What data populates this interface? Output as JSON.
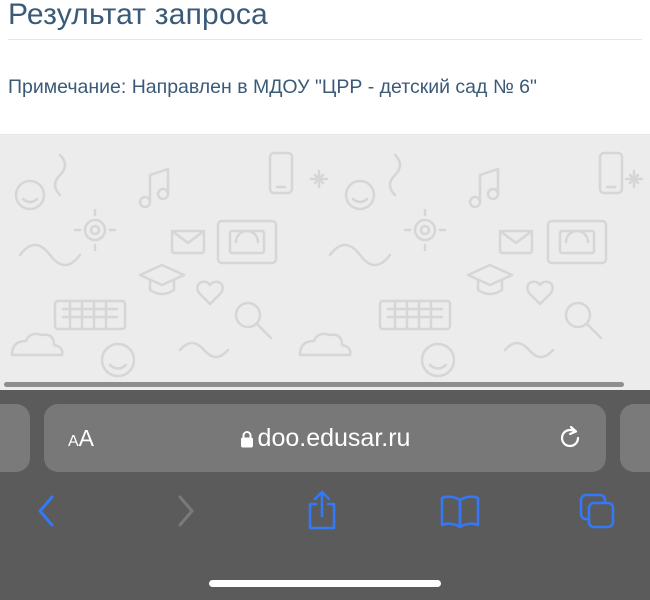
{
  "page": {
    "title": "Результат запроса",
    "note": "Примечание: Направлен в МДОУ \"ЦРР - детский сад № 6\""
  },
  "browser": {
    "text_size_button": "AA",
    "url": "doo.edusar.ru",
    "icons": {
      "lock": "lock-icon",
      "reload": "reload-icon",
      "back": "chevron-left-icon",
      "forward": "chevron-right-icon",
      "share": "share-icon",
      "bookmarks": "book-icon",
      "tabs": "tabs-icon"
    }
  },
  "colors": {
    "heading_text": "#3b5a78",
    "toolbar_bg": "#5b5b5b",
    "address_bar_bg": "#787878",
    "accent_blue": "#3478f6"
  }
}
